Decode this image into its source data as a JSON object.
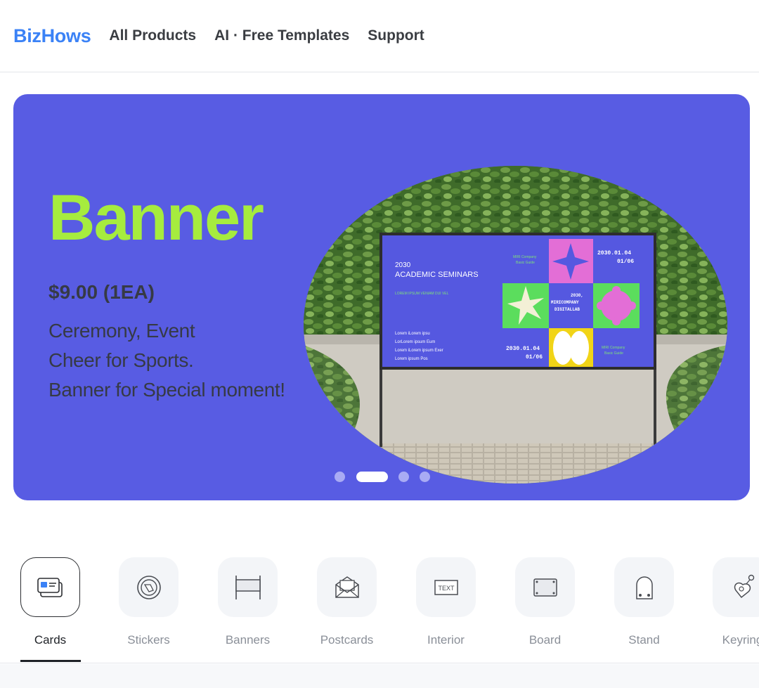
{
  "header": {
    "logo": "BizHows",
    "nav": [
      {
        "label": "All Products"
      },
      {
        "label": "AI · Free Templates"
      },
      {
        "label": "Support"
      }
    ]
  },
  "hero": {
    "title": "Banner",
    "price": "$9.00 (1EA)",
    "lines": [
      "Ceremony, Event",
      "Cheer for Sports.",
      "Banner for Special moment!"
    ],
    "background_color": "#585ce3",
    "title_color": "#a6ec3e",
    "image": {
      "heading_year": "2030",
      "heading": "ACADEMIC SEMINARS",
      "subline": "LOREM IPSUM VENIAM DUI VEL",
      "small_left": [
        "Lorem iLorem ipsu",
        "LorLorem ipsum Eum",
        "Lorem iLorem ipsum Exer",
        "Lorem ipsum Pos"
      ],
      "company_top": [
        "MIRI Company",
        "Basic Guide"
      ],
      "date_top": [
        "2030.01.04",
        "01/06"
      ],
      "center_text": [
        "2030,",
        "MIRICOMPANY",
        "DIGITALLAB"
      ],
      "date_bottom": [
        "2030.01.04",
        "01/06"
      ],
      "company_bottom": [
        "MIRI Company",
        "Basic Guide"
      ]
    },
    "carousel": {
      "total": 4,
      "active": 1
    }
  },
  "categories": [
    {
      "label": "Cards",
      "icon": "card-icon",
      "active": true
    },
    {
      "label": "Stickers",
      "icon": "sticker-icon",
      "active": false
    },
    {
      "label": "Banners",
      "icon": "banner-icon",
      "active": false
    },
    {
      "label": "Postcards",
      "icon": "envelope-icon",
      "active": false
    },
    {
      "label": "Interior",
      "icon": "text-sign-icon",
      "active": false
    },
    {
      "label": "Board",
      "icon": "board-icon",
      "active": false
    },
    {
      "label": "Stand",
      "icon": "stand-icon",
      "active": false
    },
    {
      "label": "Keyring",
      "icon": "keyring-icon",
      "active": false
    }
  ]
}
